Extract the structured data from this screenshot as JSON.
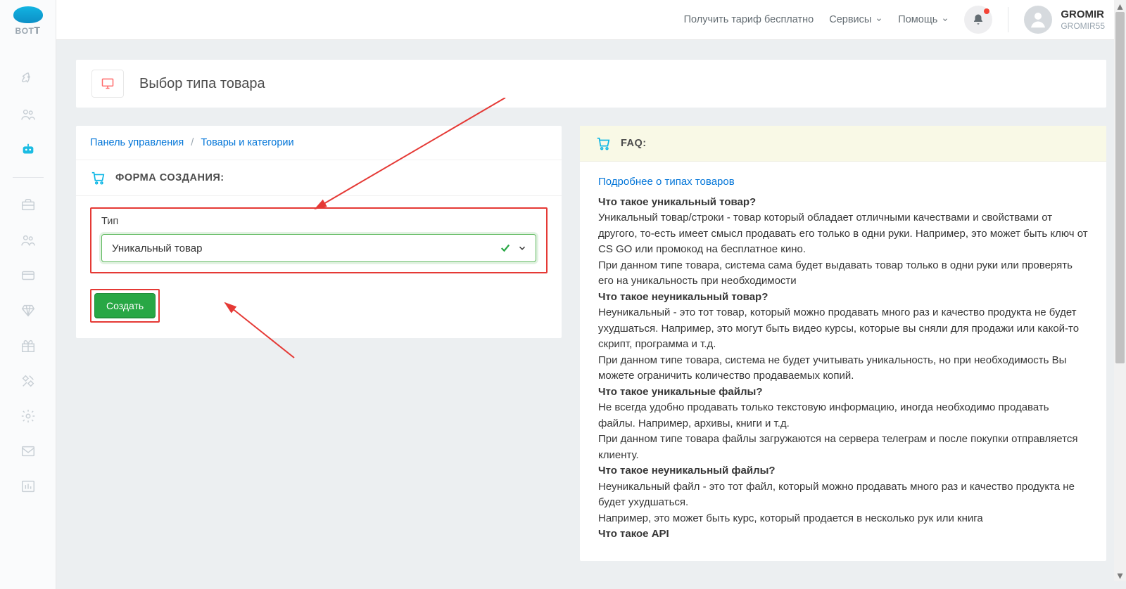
{
  "logo_text_main": "BOT",
  "logo_text_suffix": "T",
  "topbar": {
    "tariff": "Получить тариф бесплатно",
    "services": "Сервисы",
    "help": "Помощь"
  },
  "user": {
    "name": "GROMIR",
    "handle": "GROMIR55"
  },
  "page_title": "Выбор типа товара",
  "crumbs": {
    "dashboard": "Панель управления",
    "catalog": "Товары и категории"
  },
  "form": {
    "heading": "ФОРМА СОЗДАНИЯ:",
    "type_label": "Тип",
    "type_value": "Уникальный товар",
    "submit": "Создать"
  },
  "faq": {
    "heading": "FAQ:",
    "more_link": "Подробнее о типах товаров",
    "q1": "Что такое уникальный товар?",
    "a1": "Уникальный товар/строки - товар который обладает отличными качествами и свойствами от другого, то-есть имеет смысл продавать его только в одни руки. Например, это может быть ключ от CS GO или промокод на бесплатное кино.",
    "a1b": "При данном типе товара, система сама будет выдавать товар только в одни руки или проверять его на уникальность при необходимости",
    "q2": "Что такое неуникальный товар?",
    "a2": "Неуникальный - это тот товар, который можно продавать много раз и качество продукта не будет ухудшаться. Например, это могут быть видео курсы, которые вы сняли для продажи или какой-то скрипт, программа и т.д.",
    "a2b": "При данном типе товара, система не будет учитывать уникальность, но при необходимость Вы можете ограничить количество продаваемых копий.",
    "q3": "Что такое уникальные файлы?",
    "a3": "Не всегда удобно продавать только текстовую информацию, иногда необходимо продавать файлы. Например, архивы, книги и т.д.",
    "a3b": "При данном типе товара файлы загружаются на сервера телеграм и после покупки отправляется клиенту.",
    "q4": "Что такое неуникальный файлы?",
    "a4": "Неуникальный файл - это тот файл, который можно продавать много раз и качество продукта не будет ухудшаться.",
    "a4b": "Например, это может быть курс, который продается в несколько рук или книга",
    "q5": "Что такое API"
  }
}
